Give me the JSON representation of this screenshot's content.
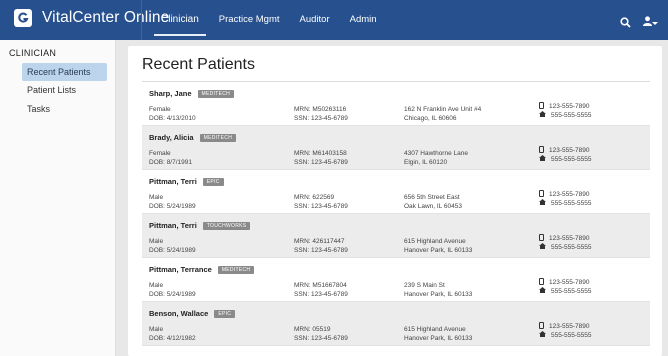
{
  "header": {
    "app_title": "VitalCenter Online",
    "nav": [
      {
        "label": "Clinician",
        "active": true
      },
      {
        "label": "Practice Mgmt"
      },
      {
        "label": "Auditor"
      },
      {
        "label": "Admin"
      }
    ]
  },
  "sidebar": {
    "heading": "CLINICIAN",
    "items": [
      {
        "label": "Recent Patients",
        "active": true
      },
      {
        "label": "Patient Lists"
      },
      {
        "label": "Tasks"
      }
    ]
  },
  "main": {
    "title": "Recent Patients",
    "patients": [
      {
        "name": "Sharp, Jane",
        "badge": "MEDITECH",
        "sex": "Female",
        "dob": "DOB: 4/13/2010",
        "mrn": "MRN: M50263116",
        "ssn": "SSN: 123-45-6789",
        "addr1": "162 N Franklin Ave Unit #4",
        "addr2": "Chicago, IL 60606",
        "mobile": "123-555-7890",
        "home": "555-555-5555"
      },
      {
        "name": "Brady, Alicia",
        "badge": "MEDITECH",
        "sex": "Female",
        "dob": "DOB: 8/7/1991",
        "mrn": "MRN: M61403158",
        "ssn": "SSN: 123-45-6789",
        "addr1": "4307 Hawthorne Lane",
        "addr2": "Elgin, IL 60120",
        "mobile": "123-555-7890",
        "home": "555-555-5555"
      },
      {
        "name": "Pittman, Terri",
        "badge": "EPIC",
        "sex": "Male",
        "dob": "DOB: 5/24/1989",
        "mrn": "MRN: 622569",
        "ssn": "SSN: 123-45-6789",
        "addr1": "656 5th Street East",
        "addr2": "Oak Lawn, IL 60453",
        "mobile": "123-555-7890",
        "home": "555-555-5555"
      },
      {
        "name": "Pittman, Terri",
        "badge": "TOUCHWORKS",
        "sex": "Male",
        "dob": "DOB: 5/24/1989",
        "mrn": "MRN: 426117447",
        "ssn": "SSN: 123-45-6789",
        "addr1": "615 Highland Avenue",
        "addr2": "Hanover Park, IL 60133",
        "mobile": "123-555-7890",
        "home": "555-555-5555"
      },
      {
        "name": "Pittman, Terrance",
        "badge": "MEDITECH",
        "sex": "Male",
        "dob": "DOB: 5/24/1989",
        "mrn": "MRN: M51667804",
        "ssn": "SSN: 123-45-6789",
        "addr1": "239 S Main St",
        "addr2": "Hanover Park, IL 60133",
        "mobile": "123-555-7890",
        "home": "555-555-5555"
      },
      {
        "name": "Benson, Wallace",
        "badge": "EPIC",
        "sex": "Male",
        "dob": "DOB: 4/12/1982",
        "mrn": "MRN: 05519",
        "ssn": "SSN: 123-45-6789",
        "addr1": "615 Highland Avenue",
        "addr2": "Hanover Park, IL 60133",
        "mobile": "123-555-7890",
        "home": "555-555-5555"
      }
    ]
  },
  "icons": {
    "logo": "app-logo-icon",
    "search": "search-icon",
    "user": "user-icon",
    "user_menu": "caret-down-icon",
    "mobile": "mobile-phone-icon",
    "home": "home-icon"
  },
  "colors": {
    "header_bg": "#27508e",
    "sidebar_active_bg": "#bcd4ec",
    "badge_bg": "#8a8a8a",
    "row_alt_bg": "#ececec",
    "page_bg": "#e8e8e8"
  }
}
